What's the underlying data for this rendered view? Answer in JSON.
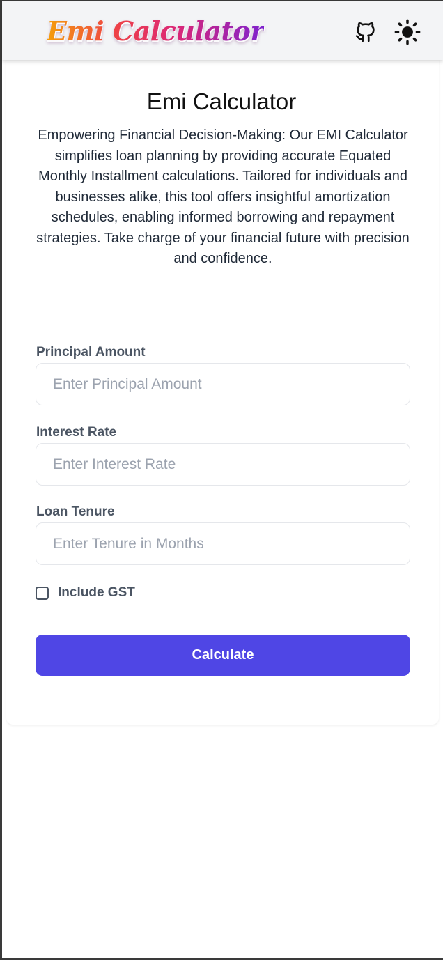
{
  "header": {
    "logo_text": "Emi Calculator",
    "github_icon": "github-icon",
    "theme_icon": "sun-icon"
  },
  "main": {
    "title": "Emi Calculator",
    "description": "Empowering Financial Decision-Making: Our EMI Calculator simplifies loan planning by providing accurate Equated Monthly Installment calculations. Tailored for individuals and businesses alike, this tool offers insightful amortization schedules, enabling informed borrowing and repayment strategies. Take charge of your financial future with precision and confidence."
  },
  "form": {
    "principal": {
      "label": "Principal Amount",
      "placeholder": "Enter Principal Amount",
      "value": ""
    },
    "interest": {
      "label": "Interest Rate",
      "placeholder": "Enter Interest Rate",
      "value": ""
    },
    "tenure": {
      "label": "Loan Tenure",
      "placeholder": "Enter Tenure in Months",
      "value": ""
    },
    "gst": {
      "label": "Include GST",
      "checked": false
    },
    "calculate_label": "Calculate"
  },
  "colors": {
    "primary_button": "#4f46e5",
    "navbar_bg": "#f3f4f6",
    "label_text": "#4b5563"
  }
}
